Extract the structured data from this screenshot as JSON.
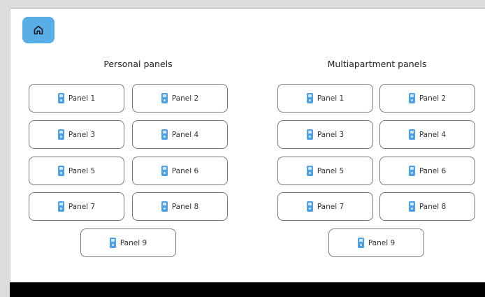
{
  "home": {
    "icon": "home-icon"
  },
  "sections": [
    {
      "title": "Personal panels",
      "panels": [
        "Panel 1",
        "Panel 2",
        "Panel 3",
        "Panel 4",
        "Panel 5",
        "Panel 6",
        "Panel 7",
        "Panel 8",
        "Panel 9"
      ]
    },
    {
      "title": "Multiapartment panels",
      "panels": [
        "Panel 1",
        "Panel 2",
        "Panel 3",
        "Panel 4",
        "Panel 5",
        "Panel 6",
        "Panel 7",
        "Panel 8",
        "Panel 9"
      ]
    }
  ],
  "colors": {
    "accent": "#5aaee8",
    "panel_icon": "#4f9fe3",
    "bottom_bar": "#000000"
  }
}
